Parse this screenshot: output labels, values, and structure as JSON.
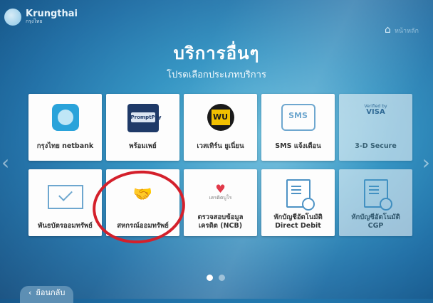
{
  "brand": {
    "name": "Krungthai",
    "sub": "กรุงไทย"
  },
  "header": {
    "home_label": "หน้าหลัก"
  },
  "title": "บริการอื่นๆ",
  "subtitle": "โปรดเลือกประเภทบริการ",
  "tiles": [
    {
      "label": "กรุงไทย netbank",
      "icon": "ktb-logo"
    },
    {
      "label": "พร้อมเพย์",
      "icon": "promptpay-logo",
      "icon_text": "PromptPay"
    },
    {
      "label": "เวสเทิร์น ยูเนี่ยน",
      "icon": "western-union-logo",
      "icon_text": "WU"
    },
    {
      "label": "SMS แจ้งเตือน",
      "icon": "sms-icon",
      "icon_text": "SMS"
    },
    {
      "label": "3-D Secure",
      "icon": "visa-logo",
      "icon_text_top": "Verified by",
      "icon_text": "VISA"
    },
    {
      "label": "พันธบัตรออมทรัพย์",
      "icon": "bond-icon"
    },
    {
      "label": "สหกรณ์ออมทรัพย์",
      "icon": "handshake-icon"
    },
    {
      "label1": "ตรวจสอบข้อมูล",
      "label2": "เครดิต (NCB)",
      "icon": "heart-icon",
      "icon_text": "เครดิตบูโร"
    },
    {
      "label1": "หักบัญชีอัตโนมัติ",
      "label2": "Direct Debit",
      "icon": "document-clock-icon"
    },
    {
      "label1": "หักบัญชีอัตโนมัติ",
      "label2": "CGP",
      "icon": "document-clock-icon"
    }
  ],
  "pagination": {
    "current": 1,
    "total": 2
  },
  "back_label": "ย้อนกลับ",
  "colors": {
    "accent": "#2b8fc0",
    "highlight_circle": "#d4202b"
  }
}
